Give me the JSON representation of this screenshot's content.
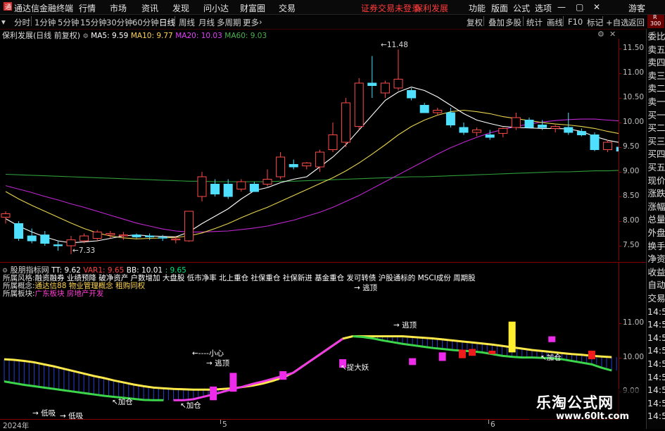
{
  "titlebar": {
    "app_name": "通达信金融终端",
    "menu": [
      "行情",
      "市场",
      "资讯",
      "发现",
      "问小达",
      "财富圈",
      "交易"
    ],
    "notice": "证券交易未登录",
    "stock": "保利发展",
    "right_menu": [
      "功能",
      "版面",
      "公式",
      "选项"
    ],
    "guest": "游客"
  },
  "toolbar": {
    "periods": [
      "分时",
      "1分钟",
      "5分钟",
      "15分钟",
      "30分钟",
      "60分钟",
      "日线",
      "周线",
      "月线",
      "多周期",
      "更多"
    ],
    "active_period": "日线",
    "right_tools": [
      "复权",
      "叠加",
      "多股",
      "统计",
      "画线",
      "F10",
      "标记",
      "+自选",
      "返回"
    ],
    "corner_r": "R",
    "corner_num": "300"
  },
  "main_chart": {
    "title": "保利发展(日线 前复权)",
    "indicators": [
      {
        "label": "MA5: 9.59",
        "color": "#ffffff"
      },
      {
        "label": "MA10: 9.77",
        "color": "#ffd54f"
      },
      {
        "label": "MA20: 10.03",
        "color": "#e040fb"
      },
      {
        "label": "MA60: 9.03",
        "color": "#4caf50"
      }
    ],
    "high_label": "11.48",
    "low_label": "7.33",
    "y_ticks": [
      "11.50",
      "11.00",
      "10.50",
      "10.00",
      "9.50",
      "9.00",
      "8.50",
      "8.00",
      "7.50"
    ]
  },
  "sub_chart": {
    "title": "股朋指标网",
    "indicators": [
      {
        "label": "TT: 9.62",
        "color": "#ffffff"
      },
      {
        "label": "VAR1: 9.65",
        "color": "#ff4040"
      },
      {
        "label": "BB: 10.01",
        "color": "#ffffff"
      },
      {
        "label": ": 9.65",
        "color": "#00e676"
      }
    ],
    "info_lines": [
      {
        "label": "所属风格:",
        "value": "融资融券 业绩预降 破净资产 户数增加 大盘股 低市净率 北上重仓 社保重仓 社保新进 基金重仓 发可转债 沪股通标的 MSCI成份 周期股",
        "color": "#ffffff"
      },
      {
        "label": "所属概念:",
        "value": "通达信88 物业管理概念 租购同权",
        "color": "#ffd54f"
      },
      {
        "label": "所属板块:",
        "value": "广东板块 房地产开发",
        "color": "#ff3bd4"
      }
    ],
    "y_ticks": [
      "11.00",
      "10.00",
      "9.00"
    ],
    "annotations": {
      "escape_top": "→ 逃顶",
      "escape_mid": "→ 逃顶",
      "escape_high": "→ 逃顶",
      "careful": "←----小心",
      "catch_monster": "↖捉大妖",
      "add_left": "↖加仓",
      "add_mid": "↖加仓",
      "add_right": "↖加仓",
      "low_absorb_1": "→ 低吸",
      "low_absorb_2": "→ 低吸"
    }
  },
  "x_axis": {
    "year": "2024年",
    "month_5": "5",
    "month_6": "6"
  },
  "right_panel": {
    "labels": [
      "委比",
      "卖五",
      "卖四",
      "卖三",
      "卖二",
      "卖一",
      "买一",
      "买二",
      "买三",
      "买四",
      "买五",
      "现价",
      "涨跌",
      "涨幅",
      "总量",
      "外盘",
      "换手",
      "净资",
      "收益",
      "自动",
      "交易",
      "14:5",
      "14:5",
      "14:5",
      "14:5",
      "14:5",
      "14:5",
      "14:5",
      "14:5",
      "14:5"
    ]
  },
  "watermark": {
    "name": "乐淘公式网",
    "url": "www.60lt.com"
  },
  "chart_data": [
    {
      "type": "candlestick",
      "title": "保利发展(日线 前复权)",
      "ylim": [
        7.2,
        11.7
      ],
      "candles": [
        {
          "o": 8.08,
          "h": 8.2,
          "l": 7.95,
          "c": 8.15
        },
        {
          "o": 7.95,
          "h": 8.0,
          "l": 7.6,
          "c": 7.65
        },
        {
          "o": 7.7,
          "h": 7.85,
          "l": 7.55,
          "c": 7.6
        },
        {
          "o": 7.72,
          "h": 7.8,
          "l": 7.5,
          "c": 7.55
        },
        {
          "o": 7.52,
          "h": 7.6,
          "l": 7.4,
          "c": 7.5
        },
        {
          "o": 7.5,
          "h": 7.7,
          "l": 7.33,
          "c": 7.62
        },
        {
          "o": 7.6,
          "h": 7.75,
          "l": 7.55,
          "c": 7.7
        },
        {
          "o": 7.65,
          "h": 7.82,
          "l": 7.6,
          "c": 7.78
        },
        {
          "o": 7.72,
          "h": 7.8,
          "l": 7.65,
          "c": 7.75
        },
        {
          "o": 7.7,
          "h": 7.78,
          "l": 7.62,
          "c": 7.72
        },
        {
          "o": 7.72,
          "h": 7.75,
          "l": 7.65,
          "c": 7.68
        },
        {
          "o": 7.7,
          "h": 7.75,
          "l": 7.62,
          "c": 7.68
        },
        {
          "o": 7.67,
          "h": 7.72,
          "l": 7.6,
          "c": 7.66
        },
        {
          "o": 7.62,
          "h": 7.7,
          "l": 7.55,
          "c": 7.64
        },
        {
          "o": 7.6,
          "h": 8.2,
          "l": 7.58,
          "c": 8.2
        },
        {
          "o": 8.5,
          "h": 9.0,
          "l": 8.4,
          "c": 8.9
        },
        {
          "o": 8.75,
          "h": 8.85,
          "l": 8.5,
          "c": 8.55
        },
        {
          "o": 8.75,
          "h": 8.85,
          "l": 8.45,
          "c": 8.5
        },
        {
          "o": 8.65,
          "h": 8.85,
          "l": 8.6,
          "c": 8.8
        },
        {
          "o": 8.75,
          "h": 8.8,
          "l": 8.6,
          "c": 8.6
        },
        {
          "o": 8.75,
          "h": 9.05,
          "l": 8.7,
          "c": 8.85
        },
        {
          "o": 8.9,
          "h": 9.4,
          "l": 8.85,
          "c": 9.3
        },
        {
          "o": 9.15,
          "h": 9.25,
          "l": 9.05,
          "c": 9.1
        },
        {
          "o": 9.12,
          "h": 9.2,
          "l": 9.05,
          "c": 9.18
        },
        {
          "o": 9.1,
          "h": 9.45,
          "l": 9.0,
          "c": 9.4
        },
        {
          "o": 9.45,
          "h": 10.0,
          "l": 9.4,
          "c": 9.75
        },
        {
          "o": 9.6,
          "h": 10.5,
          "l": 9.5,
          "c": 10.4
        },
        {
          "o": 9.92,
          "h": 10.9,
          "l": 9.85,
          "c": 10.8
        },
        {
          "o": 10.8,
          "h": 11.35,
          "l": 10.5,
          "c": 10.75
        },
        {
          "o": 10.6,
          "h": 10.85,
          "l": 10.5,
          "c": 10.8
        },
        {
          "o": 10.7,
          "h": 11.48,
          "l": 10.65,
          "c": 10.88
        },
        {
          "o": 10.65,
          "h": 10.7,
          "l": 10.45,
          "c": 10.5
        },
        {
          "o": 10.35,
          "h": 10.4,
          "l": 10.2,
          "c": 10.2
        },
        {
          "o": 10.2,
          "h": 10.3,
          "l": 10.15,
          "c": 10.25
        },
        {
          "o": 10.2,
          "h": 10.3,
          "l": 9.9,
          "c": 9.95
        },
        {
          "o": 9.9,
          "h": 10.0,
          "l": 9.75,
          "c": 9.8
        },
        {
          "o": 9.8,
          "h": 9.9,
          "l": 9.72,
          "c": 9.85
        },
        {
          "o": 9.75,
          "h": 9.85,
          "l": 9.65,
          "c": 9.7
        },
        {
          "o": 9.78,
          "h": 9.9,
          "l": 9.7,
          "c": 9.88
        },
        {
          "o": 9.9,
          "h": 10.2,
          "l": 9.85,
          "c": 10.1
        },
        {
          "o": 10.05,
          "h": 10.1,
          "l": 9.88,
          "c": 9.9
        },
        {
          "o": 9.95,
          "h": 10.05,
          "l": 9.85,
          "c": 9.9
        },
        {
          "o": 9.88,
          "h": 9.95,
          "l": 9.8,
          "c": 9.92
        },
        {
          "o": 9.9,
          "h": 10.2,
          "l": 9.75,
          "c": 9.8
        },
        {
          "o": 9.82,
          "h": 9.88,
          "l": 9.72,
          "c": 9.75
        },
        {
          "o": 9.75,
          "h": 9.8,
          "l": 9.42,
          "c": 9.45
        },
        {
          "o": 9.45,
          "h": 9.65,
          "l": 9.4,
          "c": 9.6
        },
        {
          "o": 9.5,
          "h": 9.6,
          "l": 9.3,
          "c": 9.42
        }
      ],
      "ma5": [
        8.05,
        7.9,
        7.78,
        7.68,
        7.6,
        7.56,
        7.58,
        7.6,
        7.65,
        7.7,
        7.72,
        7.7,
        7.69,
        7.68,
        7.78,
        7.95,
        8.1,
        8.25,
        8.45,
        8.62,
        8.68,
        8.78,
        8.85,
        8.9,
        9.1,
        9.3,
        9.55,
        9.85,
        10.15,
        10.45,
        10.62,
        10.72,
        10.65,
        10.52,
        10.35,
        10.18,
        10.05,
        9.98,
        9.92,
        9.9,
        9.89,
        9.88,
        9.88,
        9.87,
        9.82,
        9.72,
        9.64,
        9.59
      ],
      "ma10": [
        8.6,
        8.45,
        8.32,
        8.2,
        8.08,
        7.96,
        7.85,
        7.76,
        7.7,
        7.66,
        7.64,
        7.65,
        7.66,
        7.67,
        7.7,
        7.76,
        7.85,
        7.95,
        8.07,
        8.18,
        8.28,
        8.4,
        8.52,
        8.64,
        8.76,
        8.88,
        9.02,
        9.18,
        9.36,
        9.55,
        9.75,
        9.92,
        10.05,
        10.15,
        10.22,
        10.25,
        10.22,
        10.18,
        10.12,
        10.08,
        10.04,
        10.0,
        9.97,
        9.95,
        9.92,
        9.88,
        9.82,
        9.77
      ],
      "ma20": [
        8.72,
        8.65,
        8.58,
        8.5,
        8.43,
        8.35,
        8.28,
        8.2,
        8.12,
        8.04,
        7.96,
        7.9,
        7.84,
        7.8,
        7.78,
        7.78,
        7.79,
        7.8,
        7.83,
        7.86,
        7.9,
        7.96,
        8.02,
        8.1,
        8.18,
        8.28,
        8.4,
        8.52,
        8.66,
        8.8,
        8.94,
        9.08,
        9.22,
        9.36,
        9.49,
        9.6,
        9.7,
        9.79,
        9.86,
        9.92,
        9.97,
        10.01,
        10.04,
        10.06,
        10.07,
        10.07,
        10.05,
        10.03
      ],
      "ma60": [
        8.95,
        8.94,
        8.93,
        8.92,
        8.91,
        8.9,
        8.89,
        8.88,
        8.87,
        8.86,
        8.85,
        8.84,
        8.83,
        8.82,
        8.81,
        8.81,
        8.8,
        8.8,
        8.8,
        8.8,
        8.8,
        8.81,
        8.81,
        8.82,
        8.83,
        8.84,
        8.85,
        8.86,
        8.87,
        8.88,
        8.89,
        8.9,
        8.9,
        8.91,
        8.92,
        8.93,
        8.94,
        8.95,
        8.96,
        8.97,
        8.98,
        8.99,
        9.0,
        9.0,
        9.01,
        9.02,
        9.02,
        9.03
      ]
    },
    {
      "type": "line",
      "title": "股朋指标网",
      "ylim": [
        8.2,
        11.6
      ],
      "bb": [
        9.95,
        9.93,
        9.9,
        9.86,
        9.8,
        9.74,
        9.67,
        9.6,
        9.53,
        9.46,
        9.4,
        9.33,
        9.27,
        9.21,
        9.16,
        9.12,
        9.1,
        9.08,
        9.07,
        9.06,
        9.06,
        9.06,
        9.08,
        9.1,
        9.14,
        9.18,
        9.24,
        9.32,
        9.42,
        9.55,
        9.75,
        9.95,
        10.15,
        10.35,
        10.55,
        10.62,
        10.62,
        10.62,
        10.62,
        10.62,
        10.62,
        10.6,
        10.58,
        10.56,
        10.53,
        10.5,
        10.47,
        10.44,
        10.41,
        10.38,
        10.34,
        10.3,
        10.26,
        10.22,
        10.19,
        10.16,
        10.13,
        10.1,
        10.08,
        10.05,
        10.03,
        10.01
      ],
      "tt": [
        9.3,
        9.25,
        9.2,
        9.16,
        9.12,
        9.08,
        9.04,
        9.0,
        8.96,
        8.92,
        8.88,
        8.85,
        8.82,
        8.79,
        8.76,
        8.75,
        8.75,
        8.75,
        8.75,
        8.78,
        8.85,
        8.92,
        9.0,
        9.08,
        9.15,
        9.23,
        9.3,
        9.38,
        9.46,
        9.55,
        9.75,
        9.95,
        10.15,
        10.35,
        10.55,
        10.62,
        10.6,
        10.56,
        10.5,
        10.45,
        10.4,
        10.36,
        10.32,
        10.28,
        10.25,
        10.22,
        10.2,
        10.18,
        10.15,
        10.1,
        10.05,
        10.02,
        10.0,
        10.0,
        9.99,
        9.98,
        9.95,
        9.9,
        9.85,
        9.8,
        9.7,
        9.62
      ],
      "tt_color_segments": [
        "green",
        "magenta",
        "magenta",
        "green",
        "green"
      ],
      "signal_bars": [
        {
          "i": 21,
          "from": 8.75,
          "to": 9.15,
          "color": "magenta"
        },
        {
          "i": 23,
          "from": 9.0,
          "to": 9.55,
          "color": "magenta"
        },
        {
          "i": 28,
          "from": 9.35,
          "to": 9.6,
          "color": "magenta"
        },
        {
          "i": 34,
          "from": 9.7,
          "to": 9.95,
          "color": "magenta"
        },
        {
          "i": 41,
          "from": 9.78,
          "to": 9.98,
          "color": "magenta"
        },
        {
          "i": 44,
          "from": 9.9,
          "to": 10.15,
          "color": "magenta"
        },
        {
          "i": 46,
          "from": 9.98,
          "to": 10.23,
          "color": "red"
        },
        {
          "i": 47,
          "from": 10.05,
          "to": 10.25,
          "color": "red"
        },
        {
          "i": 49,
          "from": 10.1,
          "to": 10.2,
          "color": "red"
        },
        {
          "i": 51,
          "from": 10.15,
          "to": 11.05,
          "color": "yellow"
        },
        {
          "i": 55,
          "from": 10.45,
          "to": 10.62,
          "color": "magenta"
        },
        {
          "i": 59,
          "from": 9.95,
          "to": 10.2,
          "color": "red"
        }
      ]
    }
  ]
}
